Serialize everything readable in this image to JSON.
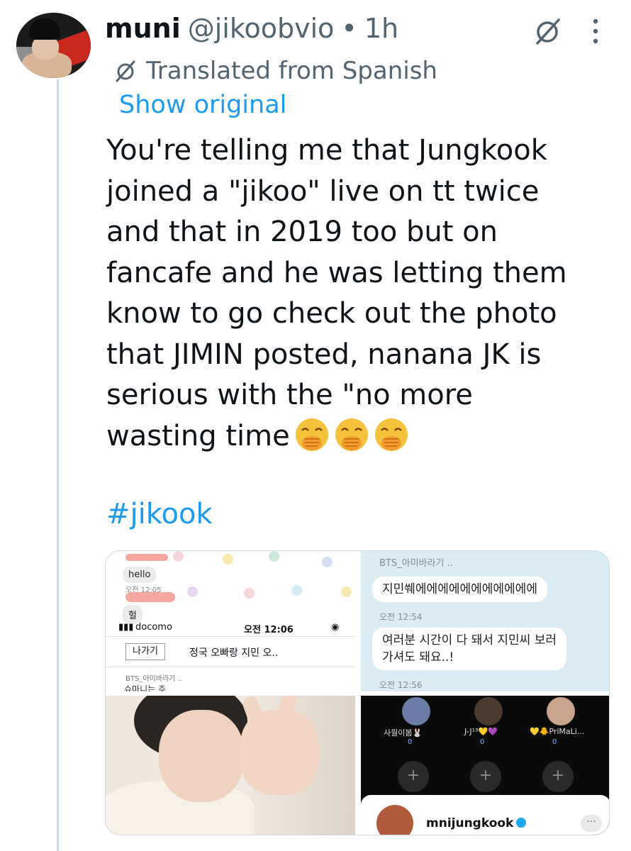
{
  "tweet": {
    "author_name": "muni",
    "author_handle": "@jikoobvio",
    "separator": "•",
    "time": "1h",
    "translated_label": "Translated from Spanish",
    "show_original_label": "Show original",
    "text_lines": [
      "You're telling me that Jungkook",
      "joined a \"jikoo\" live on tt twice",
      "and that in 2019 too but on",
      "fancafe and he was letting them",
      "know to go check out the photo",
      "that JIMIN posted, nanana JK is",
      "serious with the \"no more",
      "wasting time"
    ],
    "emojis": [
      "hand-over-mouth-emoji",
      "hand-over-mouth-emoji",
      "hand-over-mouth-emoji"
    ],
    "hashtag": "#jikook"
  },
  "icons": {
    "grok": "grok-icon",
    "more": "more-options-icon",
    "translate": "translate-icon"
  },
  "media": {
    "chat_screenshot": {
      "bubble_hello": "hello",
      "time_small": "오전 12:05",
      "bubble_heol": "헐",
      "carrier": "docomo",
      "status_time": "오전 12:06",
      "exit_button": "나가기",
      "room_title": "정국 오빠랑 지민 오..",
      "sub_name": "BTS_아미바라기 ..",
      "bottom_text": "슈마니는 주"
    },
    "fancafe_chat": {
      "header": "BTS_아미바라기 ..",
      "message1": "지민쒜에에에에에에에에에에에",
      "time1": "오전 12:54",
      "message2_line1": "여러분 시간이 다 돼서 지민씨 보러",
      "message2_line2": "가셔도 돼요..!",
      "time2": "오전 12:56"
    },
    "live_screen": {
      "guests": [
        {
          "name": "사월이봄🐰",
          "count": "0"
        },
        {
          "name": "J-J¹³💛💜",
          "count": "0"
        },
        {
          "name": "💛🐥PriMaLi...",
          "count": "0"
        }
      ],
      "plus": "+",
      "host_name": "mnijungkook",
      "more": "···"
    }
  },
  "colors": {
    "link": "#1d9bf0",
    "secondary_text": "#536471",
    "primary_text": "#0f1419",
    "thread_line": "#cfd9de"
  }
}
